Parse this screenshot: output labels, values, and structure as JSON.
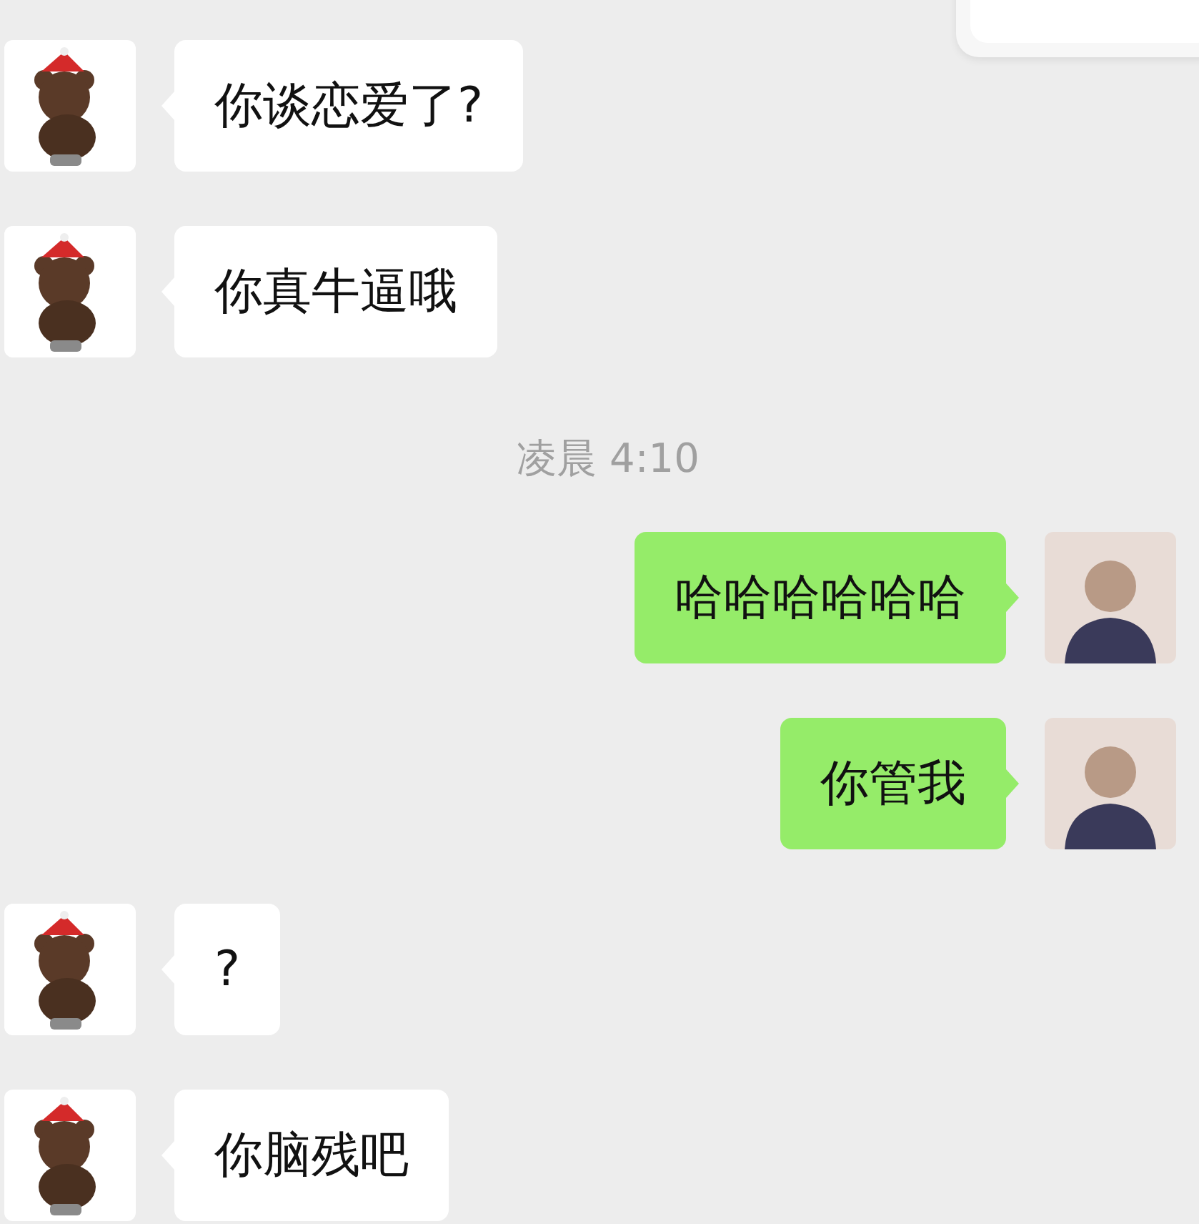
{
  "messages": [
    {
      "kind": "received",
      "text": "你谈恋爱了?"
    },
    {
      "kind": "received",
      "text": "你真牛逼哦"
    },
    {
      "kind": "time",
      "text": "凌晨 4:10"
    },
    {
      "kind": "sent",
      "text": "哈哈哈哈哈哈"
    },
    {
      "kind": "sent",
      "text": "你管我"
    },
    {
      "kind": "received",
      "text": "?"
    },
    {
      "kind": "received",
      "text": "你脑残吧"
    }
  ]
}
